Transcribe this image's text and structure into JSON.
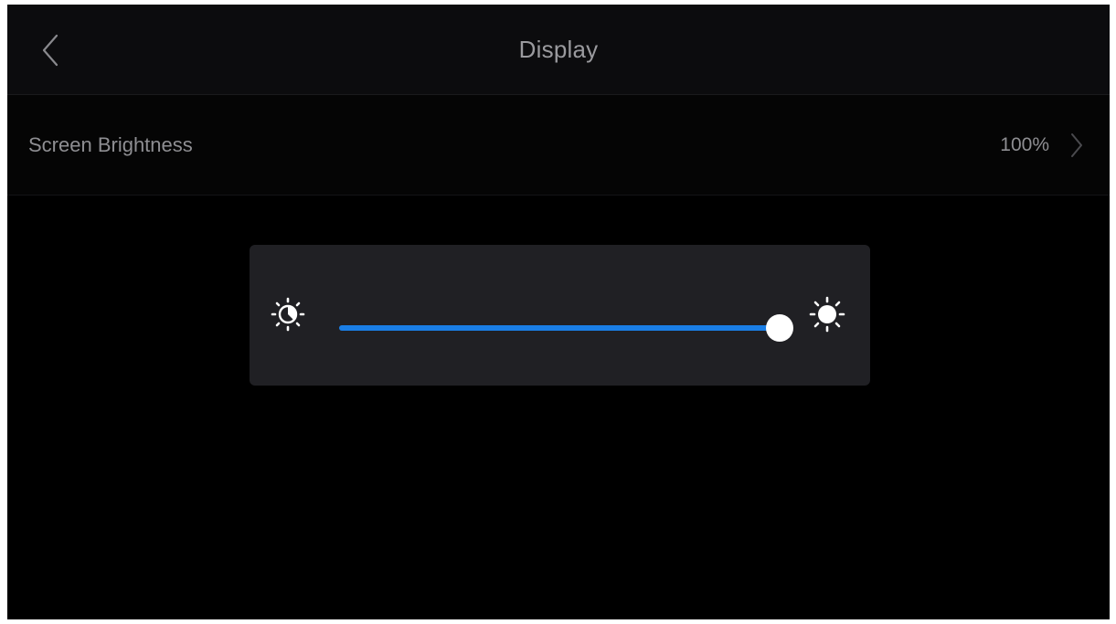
{
  "header": {
    "title": "Display",
    "back_icon": "chevron-left-icon"
  },
  "settings": {
    "screen_brightness": {
      "label": "Screen Brightness",
      "value": "100%",
      "chevron_icon": "chevron-right-icon"
    }
  },
  "brightness_slider": {
    "level": 1.0,
    "low_icon": "sun-low-icon",
    "high_icon": "sun-high-icon"
  },
  "colors": {
    "accent": "#1a7ee6",
    "background": "#000000",
    "panel": "#202024",
    "text": "#8e8e92"
  }
}
